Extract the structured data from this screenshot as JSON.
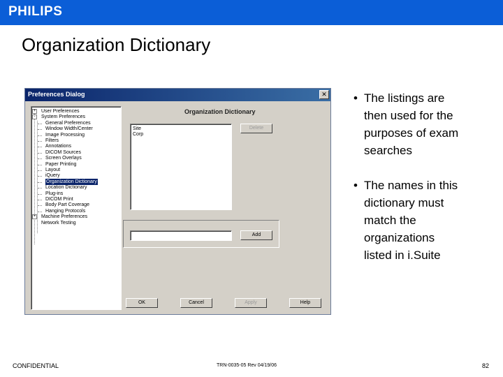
{
  "brand": {
    "logo_text": "PHILIPS",
    "color": "#0b5ed7"
  },
  "slide": {
    "title": "Organization Dictionary"
  },
  "dialog": {
    "title": "Preferences Dialog",
    "close_glyph": "✕",
    "tree": {
      "items": [
        {
          "label": "User Preferences",
          "level": 0,
          "expander": "+",
          "selected": false
        },
        {
          "label": "System Preferences",
          "level": 0,
          "expander": "-",
          "selected": false
        },
        {
          "label": "General Preferences",
          "level": 1,
          "selected": false
        },
        {
          "label": "Window Width/Center",
          "level": 1,
          "selected": false
        },
        {
          "label": "Image Processing",
          "level": 1,
          "selected": false
        },
        {
          "label": "Filters",
          "level": 1,
          "selected": false
        },
        {
          "label": "Annotations",
          "level": 1,
          "selected": false
        },
        {
          "label": "DICOM Sources",
          "level": 1,
          "selected": false
        },
        {
          "label": "Screen Overlays",
          "level": 1,
          "selected": false
        },
        {
          "label": "Paper Printing",
          "level": 1,
          "selected": false
        },
        {
          "label": "Layout",
          "level": 1,
          "selected": false
        },
        {
          "label": "iQuery",
          "level": 1,
          "selected": false
        },
        {
          "label": "Organization Dictionary",
          "level": 1,
          "selected": true
        },
        {
          "label": "Location Dictionary",
          "level": 1,
          "selected": false
        },
        {
          "label": "Plug-ins",
          "level": 1,
          "selected": false
        },
        {
          "label": "DICOM Print",
          "level": 1,
          "selected": false
        },
        {
          "label": "Body Part Coverage",
          "level": 1,
          "selected": false
        },
        {
          "label": "Hanging Protocols",
          "level": 1,
          "selected": false
        },
        {
          "label": "Machine Preferences",
          "level": 0,
          "expander": "+",
          "selected": false
        },
        {
          "label": "Network Testing",
          "level": 0,
          "selected": false
        }
      ]
    },
    "panel": {
      "heading": "Organization Dictionary",
      "list_items": [
        "Site",
        "Corp"
      ],
      "delete_label": "Delete",
      "add_input_value": "",
      "add_label": "Add"
    },
    "buttons": {
      "ok": "OK",
      "cancel": "Cancel",
      "apply": "Apply",
      "help": "Help"
    }
  },
  "bullets": [
    {
      "marker": "•",
      "text_lines": [
        "The listings are",
        "then used for the",
        "purposes of exam",
        "searches"
      ]
    },
    {
      "marker": "•",
      "text_lines": [
        "The names in this",
        "dictionary must",
        "match the",
        "organizations",
        "listed in i.Suite"
      ]
    }
  ],
  "footer": {
    "left": "CONFIDENTIAL",
    "center": "TRN-0035-05 Rev 04/19/06",
    "page_number": "82"
  }
}
